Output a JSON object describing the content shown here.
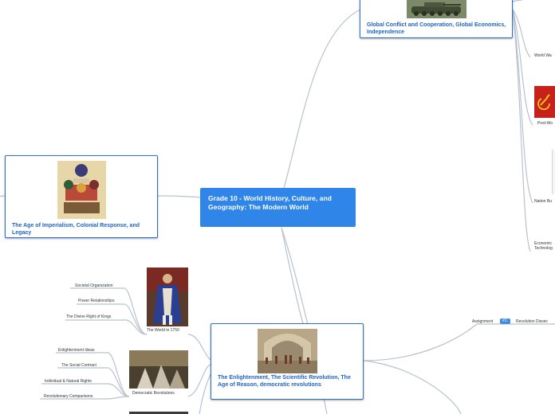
{
  "central": {
    "title": "Grade 10 - World History, Culture, and Geography: The Modern World"
  },
  "topics": {
    "global": {
      "title": "Global Conflict and Cooperation, Global Economics, Independence"
    },
    "imperialism": {
      "title": "The Age of Imperialism, Colonial Response, and Legacy"
    },
    "enlightenment": {
      "title": "The Enlightenment, The Scientific Revolution, The Age of Reason, democratic revolutions"
    }
  },
  "subtopics": {
    "world_1750": "The World in 1750",
    "democratic_revolutions": "Democratic Revolutions"
  },
  "leaves": {
    "world_1750": [
      "Societal Organization",
      "Power Relationships",
      "The Divine Right of Kings"
    ],
    "democratic_revolutions": [
      "Enlightenment Ideas",
      "The Social Contract",
      "Individual & Natural Rights",
      "Revolutionary Comparisons"
    ],
    "global_right": [
      "World Wa",
      "Post-Wo",
      "Nation Bu",
      "Economic",
      "Technolog"
    ]
  },
  "assignment": {
    "label": "Assignment",
    "badge": "#1:",
    "text": "Revolution Dissec"
  },
  "colors": {
    "accent": "#2f86e8",
    "border": "#2f6fd6",
    "link": "#b8c2ce"
  }
}
